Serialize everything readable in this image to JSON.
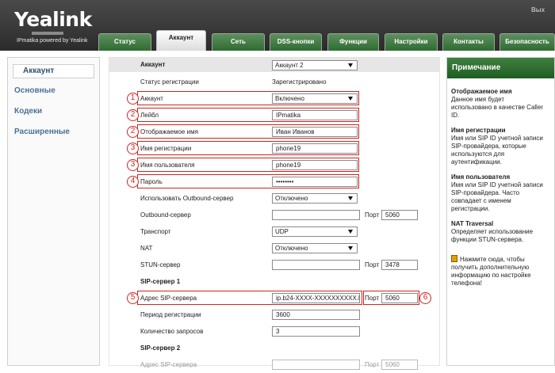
{
  "header": {
    "logo": "Yealink",
    "tagline": "IPmatika powered by Yealink",
    "corner_text": "Вых",
    "tabs": [
      {
        "label": "Статус",
        "active": false
      },
      {
        "label": "Аккаунт",
        "active": true
      },
      {
        "label": "Сеть",
        "active": false
      },
      {
        "label": "DSS-кнопки",
        "active": false
      },
      {
        "label": "Функции",
        "active": false
      },
      {
        "label": "Настройки",
        "active": false
      },
      {
        "label": "Контакты",
        "active": false
      },
      {
        "label": "Безопасность",
        "active": false
      }
    ]
  },
  "sidebar": {
    "items": [
      {
        "label": "Аккаунт",
        "active": true
      },
      {
        "label": "Основные",
        "active": false
      },
      {
        "label": "Кодеки",
        "active": false
      },
      {
        "label": "Расширенные",
        "active": false
      }
    ]
  },
  "form": {
    "account_header": {
      "label": "Аккаунт",
      "value": "Аккаунт 2"
    },
    "registration_status": {
      "label": "Статус регистрации",
      "value": "Зарегистрировано"
    },
    "account_enable": {
      "label": "Аккаунт",
      "value": "Включено"
    },
    "label": {
      "label": "Лейбл",
      "value": "IPmatika"
    },
    "display_name": {
      "label": "Отображаемое имя",
      "value": "Иван Иванов"
    },
    "register_name": {
      "label": "Имя регистрации",
      "value": "phone19"
    },
    "user_name": {
      "label": "Имя пользователя",
      "value": "phone19"
    },
    "password": {
      "label": "Пароль",
      "value": "••••••••"
    },
    "outbound_enable": {
      "label": "Использовать Outbound-сервер",
      "value": "Отключено"
    },
    "outbound_server": {
      "label": "Outbound-сервер",
      "value": "",
      "port_label": "Порт",
      "port": "5060"
    },
    "transport": {
      "label": "Транспорт",
      "value": "UDP"
    },
    "nat": {
      "label": "NAT",
      "value": "Отключено"
    },
    "stun_server": {
      "label": "STUN-сервер",
      "value": "",
      "port_label": "Порт",
      "port": "3478"
    },
    "sip1_title": "SIP-сервер 1",
    "sip1_address": {
      "label": "Адрес SIP-сервера",
      "value": "ip.b24-XXXX-XXXXXXXXXX.b",
      "port_label": "Порт",
      "port": "5060"
    },
    "sip1_period": {
      "label": "Период регистрации",
      "value": "3600"
    },
    "sip1_retries": {
      "label": "Количество запросов",
      "value": "3"
    },
    "sip2_title": "SIP-сервер 2",
    "sip2_address": {
      "label": "Адрес SIP-сервера",
      "value": "",
      "port_label": "Порт",
      "port": "5060"
    }
  },
  "annotations": {
    "badges": [
      "1",
      "2",
      "2",
      "3",
      "3",
      "4",
      "5",
      "6"
    ],
    "color": "#d1241d"
  },
  "help": {
    "title": "Примечание",
    "sections": [
      {
        "heading": "Отображаемое имя",
        "lines": [
          "Данное имя будет",
          "использовано в качестве Caller",
          "ID."
        ]
      },
      {
        "heading": "Имя регистрации",
        "lines": [
          "Имя или SIP ID учетной записи",
          "SIP-провайдера, которые",
          "используются для",
          "аутентификации."
        ]
      },
      {
        "heading": "Имя пользователя",
        "lines": [
          "Имя или SIP ID учетной записи",
          "SIP-провайдера. Часто",
          "совпадает с именем",
          "регистрации."
        ]
      },
      {
        "heading": "NAT Traversal",
        "lines": [
          "Определяет использование",
          "функции STUN-сервера."
        ]
      }
    ],
    "hint_lines": [
      "Нажмите сюда, чтобы",
      "получить дополнительную",
      "информацию по настройке",
      "телефона!"
    ]
  },
  "colors": {
    "accent_green": "#2f6b32",
    "link_blue": "#4a7296"
  }
}
